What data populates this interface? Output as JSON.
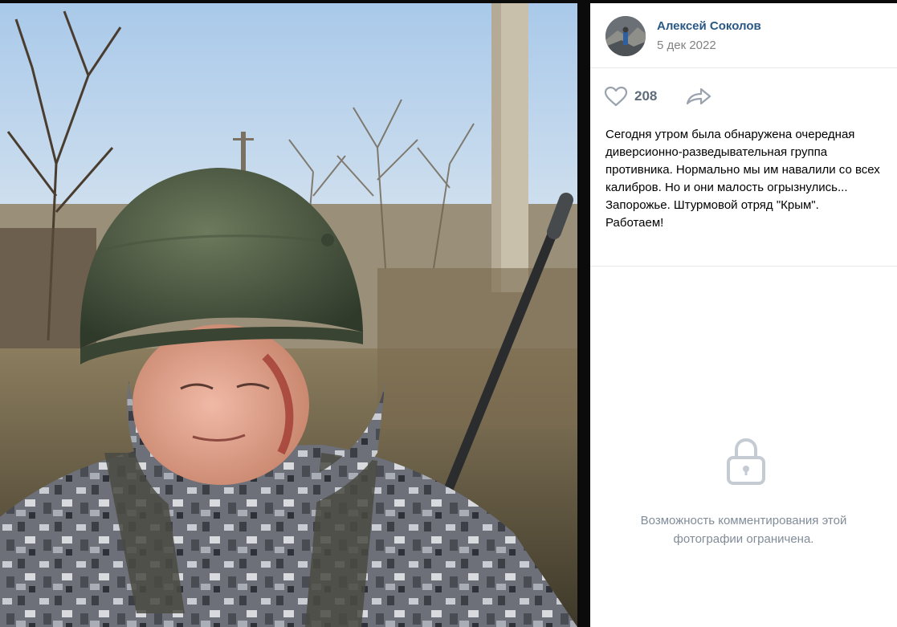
{
  "post": {
    "author_name": "Алексей Соколов",
    "date": "5 дек 2022",
    "likes": "208",
    "text": "Сегодня утром была обнаружена очередная диверсионно-разведывательная группа противника. Нормально мы им навалили со всех калибров. Но и они малость огрызнулись...\nЗапорожье. Штурмовой отряд \"Крым\".\nРаботаем!"
  },
  "comments": {
    "restricted_note": "Возможность комментирования этой\nфотографии ограничена."
  },
  "icons": {
    "like": "heart-icon",
    "share": "share-arrow-icon",
    "lock": "lock-icon"
  },
  "colors": {
    "author_link": "#2a5885",
    "muted_text": "#828282",
    "like_count": "#5e6b7a",
    "icon_gray": "#99a2ad",
    "note_text": "#818c99"
  }
}
